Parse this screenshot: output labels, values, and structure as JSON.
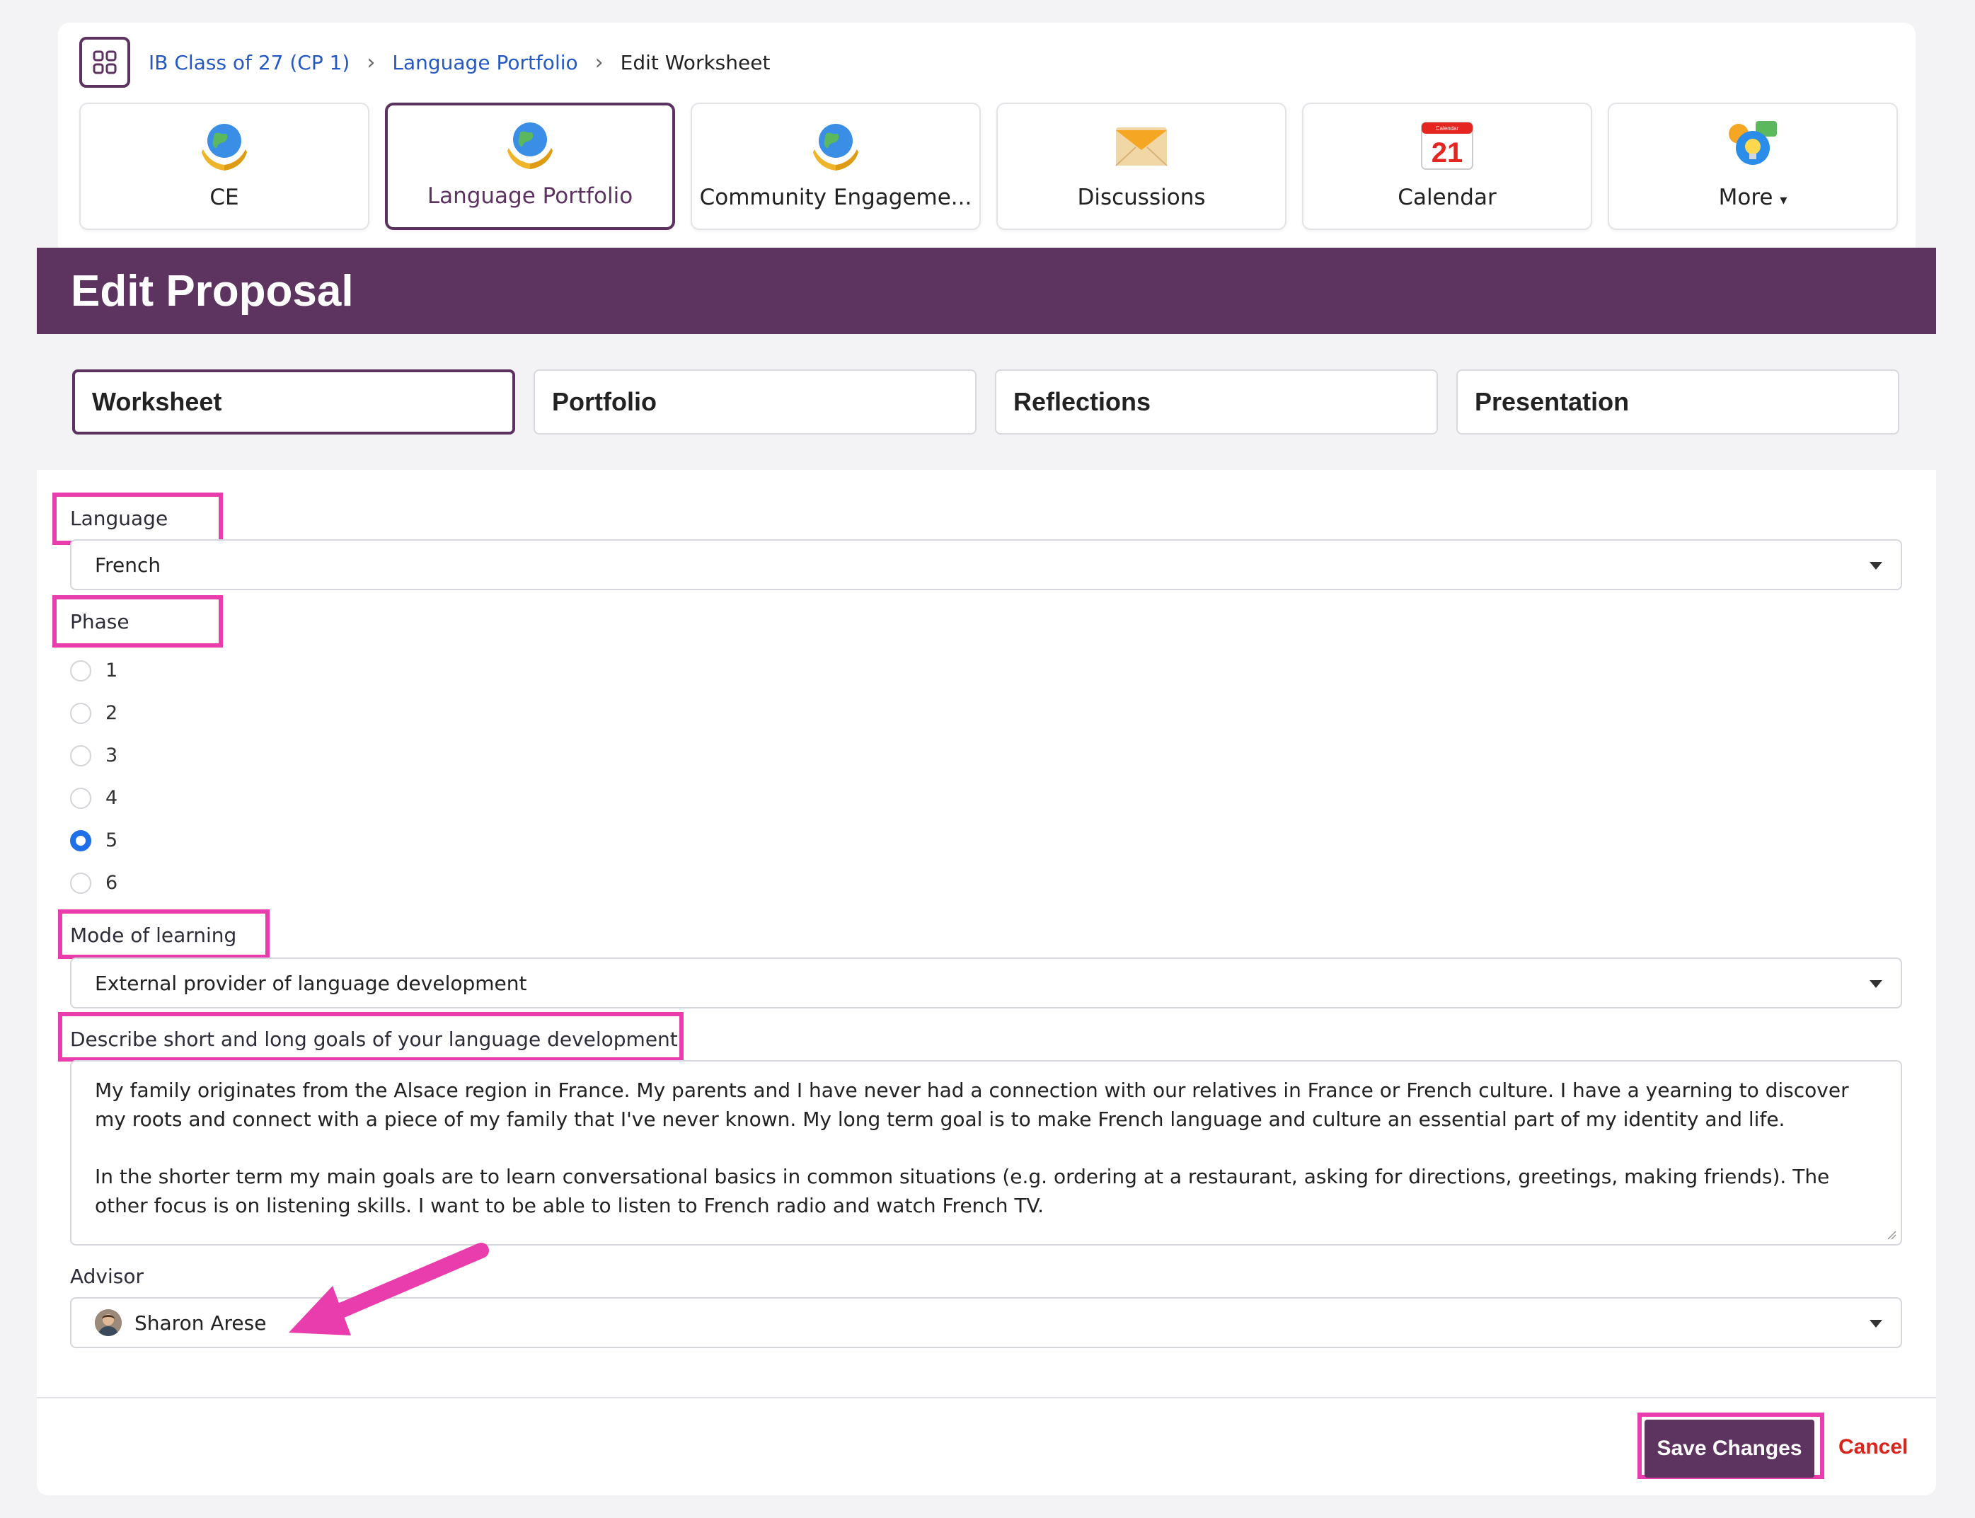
{
  "breadcrumb": {
    "items": [
      {
        "label": "IB Class of 27 (CP 1)"
      },
      {
        "label": "Language Portfolio"
      },
      {
        "label": "Edit Worksheet"
      }
    ]
  },
  "tiles": [
    {
      "label": "CE",
      "icon": "globe-hands-icon"
    },
    {
      "label": "Language Portfolio",
      "icon": "globe-hands-icon",
      "active": true
    },
    {
      "label": "Community Engageme...",
      "icon": "globe-hands-icon"
    },
    {
      "label": "Discussions",
      "icon": "envelope-icon"
    },
    {
      "label": "Calendar",
      "icon": "calendar-icon",
      "calendar_top": "Calendar",
      "calendar_day": "21"
    },
    {
      "label": "More",
      "icon": "lightbulb-chat-icon"
    }
  ],
  "page": {
    "title": "Edit Proposal"
  },
  "subtabs": [
    {
      "label": "Worksheet",
      "active": true
    },
    {
      "label": "Portfolio"
    },
    {
      "label": "Reflections"
    },
    {
      "label": "Presentation"
    }
  ],
  "form": {
    "language": {
      "label": "Language",
      "value": "French"
    },
    "phase": {
      "label": "Phase",
      "options": [
        "1",
        "2",
        "3",
        "4",
        "5",
        "6"
      ],
      "selected": "5"
    },
    "mode": {
      "label": "Mode of learning",
      "value": "External provider of language development"
    },
    "goals": {
      "label": "Describe short and long goals of your language development",
      "paragraph1": "My family originates from the Alsace region in France. My parents and I have never had a connection with our relatives in France or French culture. I have a yearning to discover my roots and connect with a piece of my family that I've never known. My long term goal is to make French language and culture an essential part of my identity and life.",
      "paragraph2": "In the shorter term my main goals are to learn conversational basics in common situations (e.g. ordering at a restaurant, asking for directions, greetings, making friends). The other focus is on listening skills. I want to be able to listen to French radio and watch French TV."
    },
    "advisor": {
      "label": "Advisor",
      "value": "Sharon Arese"
    }
  },
  "actions": {
    "save_label": "Save Changes",
    "cancel_label": "Cancel"
  },
  "colors": {
    "brand": "#5d3360",
    "highlight": "#e93cad",
    "link": "#2459c4",
    "cancel": "#d9241b",
    "radio_selected": "#1e6fe8"
  }
}
